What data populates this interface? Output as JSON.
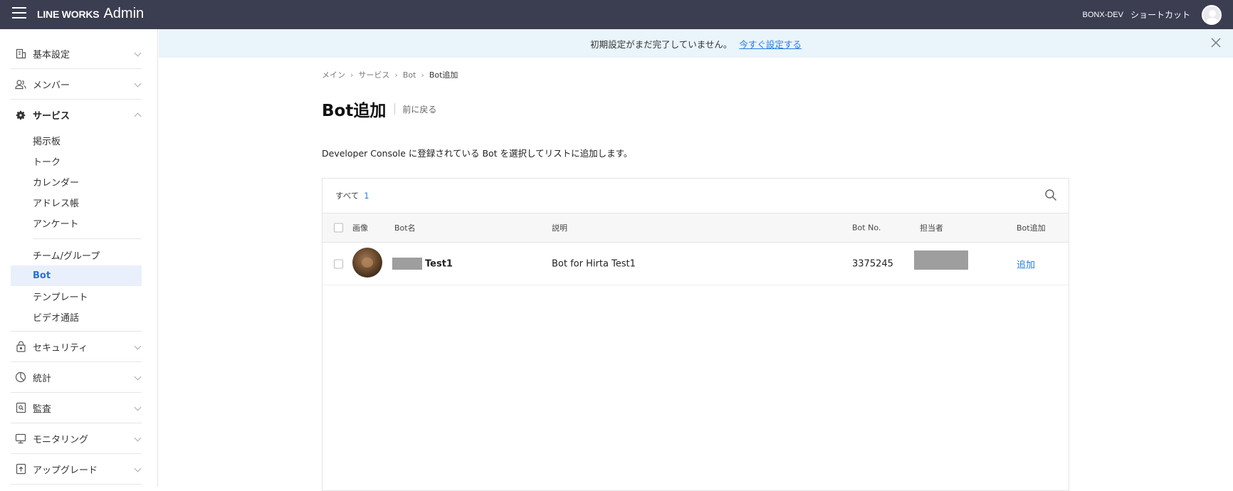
{
  "header": {
    "logo_main": "LINE WORKS",
    "logo_sub": "Admin",
    "company": "BONX-DEV",
    "shortcut_label": "ショートカット"
  },
  "sidebar": {
    "sections_top": [
      {
        "label": "基本設定",
        "icon": "building-icon"
      },
      {
        "label": "メンバー",
        "icon": "members-icon"
      }
    ],
    "services": {
      "label": "サービス",
      "icon": "gear-icon",
      "items_a": [
        "掲示板",
        "トーク",
        "カレンダー",
        "アドレス帳",
        "アンケート"
      ],
      "items_b": [
        "チーム/グループ",
        "Bot",
        "テンプレート",
        "ビデオ通話"
      ],
      "active": "Bot"
    },
    "sections_bottom": [
      {
        "label": "セキュリティ",
        "icon": "lock-icon"
      },
      {
        "label": "統計",
        "icon": "pie-chart-icon"
      },
      {
        "label": "監査",
        "icon": "audit-icon"
      },
      {
        "label": "モニタリング",
        "icon": "monitor-icon"
      },
      {
        "label": "アップグレード",
        "icon": "upgrade-icon"
      }
    ]
  },
  "banner": {
    "text": "初期設定がまだ完了していません。",
    "link": "今すぐ設定する"
  },
  "breadcrumb": [
    "メイン",
    "サービス",
    "Bot",
    "Bot追加"
  ],
  "page": {
    "title": "Bot追加",
    "back": "前に戻る",
    "description": "Developer Console に登録されている Bot を選択してリストに追加します。"
  },
  "table": {
    "filter_label": "すべて",
    "filter_count": "1",
    "columns": {
      "image": "画像",
      "name": "Bot名",
      "desc": "説明",
      "no": "Bot No.",
      "owner": "担当者",
      "add": "Bot追加"
    },
    "rows": [
      {
        "name": "Test1",
        "desc": "Bot for Hirta Test1",
        "no": "3375245",
        "add": "追加"
      }
    ]
  }
}
